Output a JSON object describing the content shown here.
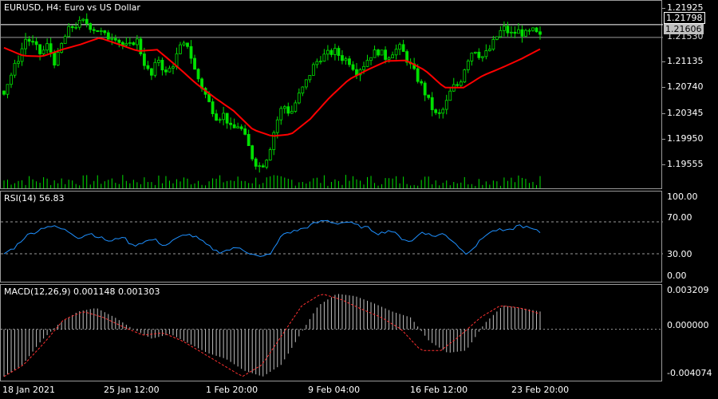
{
  "colors": {
    "background": "#000000",
    "frame": "#9a9a9a",
    "candle": "#00e000",
    "ma": "#ff0000",
    "rsi_line": "#1e90ff",
    "macd_hist": "#c0c0c0",
    "macd_signal": "#ff3030",
    "ask_line": "#ffffff",
    "bid_badge_bg": "#c0c0c0"
  },
  "main": {
    "title": "EURUSD, H4:  Euro vs US Dollar",
    "price_axis": [
      "1.21925",
      "1.21135",
      "1.20740",
      "1.20345",
      "1.19950",
      "1.19555"
    ],
    "price_hidden": "1.21530",
    "ask_label": "1.21798",
    "bid_label": "1.21606"
  },
  "rsi": {
    "label": "RSI(14) 56.83",
    "axis": [
      "100.00",
      "70.00",
      "30.00",
      "0.00"
    ],
    "levels": [
      70,
      30
    ]
  },
  "macd": {
    "label": "MACD(12,26,9) 0.001148 0.001303",
    "axis": [
      "0.003209",
      "0.000000",
      "-0.004074"
    ]
  },
  "time_axis": [
    "18 Jan 2021",
    "25 Jan 12:00",
    "1 Feb 20:00",
    "9 Feb 04:00",
    "16 Feb 12:00",
    "23 Feb 20:00"
  ],
  "chart_data": {
    "type": "candlestick",
    "symbol": "EURUSD",
    "timeframe": "H4",
    "ylim": [
      1.1936,
      1.2212
    ],
    "close_path": [
      1.208,
      1.2105,
      1.213,
      1.216,
      1.215,
      1.2135,
      1.215,
      1.212,
      1.2155,
      1.2175,
      1.218,
      1.2185,
      1.2175,
      1.217,
      1.216,
      1.2165,
      1.215,
      1.2145,
      1.216,
      1.2125,
      1.21,
      1.213,
      1.2105,
      1.212,
      1.2145,
      1.215,
      1.211,
      1.2085,
      1.206,
      1.204,
      1.2045,
      1.202,
      1.203,
      1.2005,
      1.1975,
      1.1965,
      1.1985,
      1.203,
      1.206,
      1.2045,
      1.207,
      1.209,
      1.2115,
      1.213,
      1.2135,
      1.214,
      1.213,
      1.2125,
      1.211,
      1.212,
      1.2135,
      1.214,
      1.213,
      1.214,
      1.2145,
      1.2125,
      1.2105,
      1.2085,
      1.206,
      1.204,
      1.2055,
      1.2085,
      1.209,
      1.2125,
      1.2145,
      1.213,
      1.214,
      1.216,
      1.2175,
      1.2165,
      1.217,
      1.2165,
      1.217,
      1.2161
    ],
    "ma_path": [
      1.2145,
      1.2133,
      1.2132,
      1.2142,
      1.215,
      1.216,
      1.215,
      1.214,
      1.2142,
      1.2118,
      1.2092,
      1.207,
      1.205,
      1.2022,
      1.2012,
      1.2015,
      1.2038,
      1.207,
      1.2097,
      1.2112,
      1.2125,
      1.2126,
      1.2111,
      1.2085,
      1.2085,
      1.2103,
      1.2115,
      1.2128,
      1.2143
    ],
    "ask": 1.21798,
    "bid": 1.21606,
    "rsi_path": [
      30,
      38,
      52,
      58,
      65,
      63,
      58,
      50,
      56,
      50,
      45,
      52,
      40,
      45,
      48,
      40,
      48,
      55,
      50,
      40,
      32,
      35,
      38,
      30,
      25,
      32,
      55,
      58,
      62,
      68,
      72,
      68,
      70,
      65,
      62,
      55,
      60,
      50,
      45,
      58,
      52,
      55,
      45,
      30,
      40,
      55,
      60,
      58,
      66,
      62,
      57
    ],
    "rsi_last": 56.83,
    "macd_hist_path": [
      -0.004,
      -0.003,
      -0.001,
      0.0005,
      0.0015,
      0.0018,
      0.001,
      0.0,
      -0.0008,
      -0.0004,
      -0.0012,
      -0.002,
      -0.0025,
      -0.0035,
      -0.004,
      -0.003,
      -0.0005,
      0.002,
      0.003,
      0.0028,
      0.0022,
      0.0015,
      0.001,
      -0.001,
      -0.002,
      -0.0018,
      0.0005,
      0.002,
      0.0018,
      0.0015
    ],
    "macd_signal_path": [
      -0.004,
      -0.003,
      -0.0012,
      0.0008,
      0.0015,
      0.001,
      0.0002,
      -0.0005,
      -0.0003,
      -0.001,
      -0.002,
      -0.003,
      -0.004,
      -0.003,
      -0.0005,
      0.002,
      0.003,
      0.0025,
      0.0017,
      0.001,
      0.0,
      -0.0018,
      -0.0018,
      -0.0005,
      0.001,
      0.002,
      0.0018,
      0.0013
    ],
    "macd_main": 0.001148,
    "macd_signal": 0.001303,
    "macd_ylim": [
      -0.004074,
      0.003209
    ]
  }
}
